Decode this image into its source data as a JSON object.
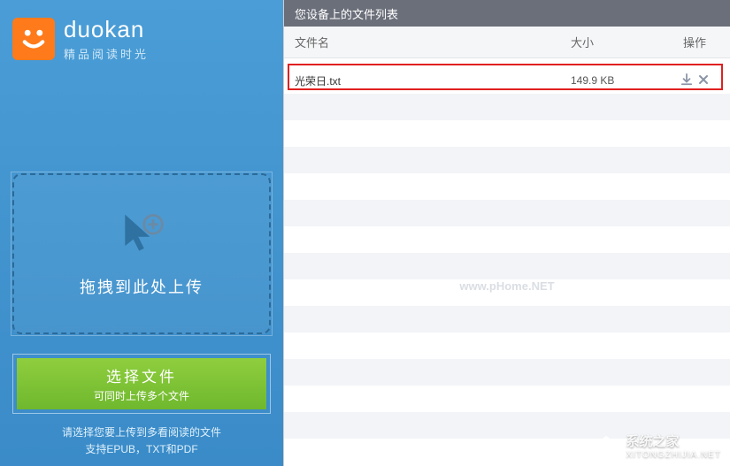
{
  "brand": {
    "name": "duokan",
    "sub": "精品阅读时光"
  },
  "dropzone": {
    "label": "拖拽到此处上传"
  },
  "select_button": {
    "title": "选择文件",
    "subtitle": "可同时上传多个文件"
  },
  "hint": {
    "line1": "请选择您要上传到多看阅读的文件",
    "line2": "支持EPUB，TXT和PDF"
  },
  "main": {
    "header": "您设备上的文件列表",
    "columns": {
      "name": "文件名",
      "size": "大小",
      "op": "操作"
    },
    "files": [
      {
        "name": "光荣日.txt",
        "size": "149.9 KB"
      }
    ],
    "watermark": "www.pHome.NET"
  },
  "site_watermark": {
    "title": "系统之家",
    "url": "XITONGZHIJIA.NET"
  }
}
